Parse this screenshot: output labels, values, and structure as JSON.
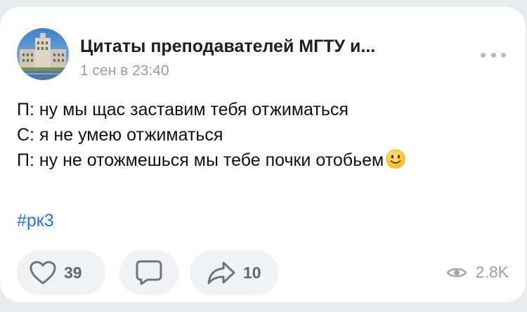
{
  "post": {
    "community_name": "Цитаты преподавателей МГТУ и...",
    "date": "1 сен в 23:40",
    "lines": [
      "П: ну мы щас заставим тебя отжиматься",
      "С: я не умею отжиматься",
      "П: ну не отожмешься мы тебе почки отобьем"
    ],
    "emoji": "slightly-smiling-face-icon",
    "hashtag": "#рк3"
  },
  "actions": {
    "likes": "39",
    "shares": "10",
    "views": "2.8K"
  },
  "colors": {
    "background": "#e9eaee",
    "card": "#ffffff",
    "hashtag": "#2a78d6",
    "muted": "#9a9da3",
    "pill": "#f1f2f5"
  }
}
